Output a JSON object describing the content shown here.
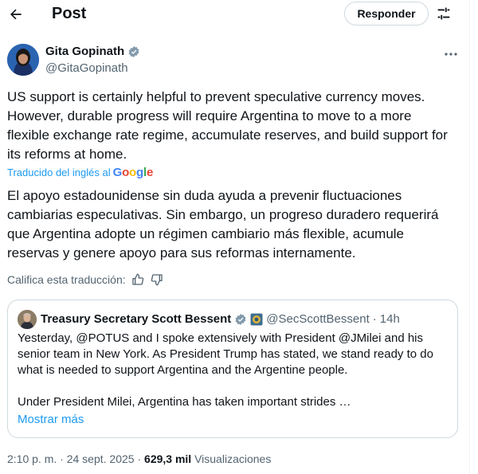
{
  "header": {
    "title": "Post",
    "reply_label": "Responder",
    "back_icon": "arrow-left-icon",
    "filter_icon": "sliders-icon"
  },
  "author": {
    "name": "Gita Gopinath",
    "handle": "@GitaGopinath",
    "verified_color": "#829aab"
  },
  "tweet": {
    "text": "US support is certainly helpful to prevent speculative currency moves. However, durable progress will require Argentina to move to a more flexible exchange rate regime, accumulate reserves, and build support for its reforms at home.",
    "translated_by": "Traducido del inglés al",
    "translator_brand": "Google",
    "translation": "El apoyo estadounidense sin duda ayuda a prevenir fluctuaciones cambiarias especulativas. Sin embargo, un progreso duradero requerirá que Argentina adopte un régimen cambiario más flexible, acumule reservas y genere apoyo para sus reformas internamente.",
    "rate_label": "Califica esta traducción:"
  },
  "quote": {
    "name": "Treasury Secretary Scott Bessent",
    "handle": "@SecScottBessent",
    "separator": "·",
    "time": "14h",
    "text_p1": "Yesterday, @POTUS and I spoke extensively with President @JMilei and his senior team in New York.  As President Trump has stated, we stand ready to do what is needed to support Argentina and the Argentine people.",
    "text_p2": "Under President Milei, Argentina has taken important strides …",
    "show_more": "Mostrar más"
  },
  "meta": {
    "time": "2:10 p. m.",
    "separator": "·",
    "date": "24 sept. 2025",
    "separator2": "·",
    "views_count": "629,3 mil",
    "views_label": "Visualizaciones"
  },
  "colors": {
    "accent": "#1d9bf0",
    "muted": "#536471",
    "border": "#cfd9de"
  }
}
